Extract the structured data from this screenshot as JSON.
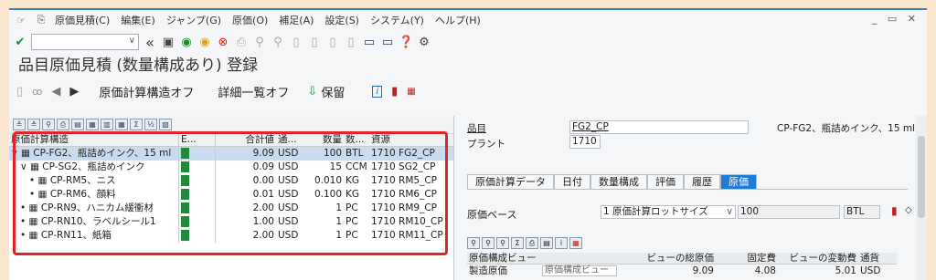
{
  "menu": {
    "items": [
      "原価見積(C)",
      "編集(E)",
      "ジャンプ(G)",
      "原価(O)",
      "補足(A)",
      "設定(S)",
      "システム(Y)",
      "ヘルプ(H)"
    ],
    "window_controls": "_ ▭ ✕"
  },
  "toolbar": {
    "command_placeholder": "",
    "icons": [
      "enter-icon",
      "save-icon",
      "back-icon",
      "exit-icon",
      "cancel-icon",
      "print-icon",
      "find-icon",
      "find-next-icon",
      "first-page-icon",
      "prev-page-icon",
      "next-page-icon",
      "last-page-icon",
      "new-session-icon",
      "shortcut-icon",
      "help-icon",
      "settings-icon"
    ]
  },
  "title": "品目原価見積 (数量構成あり) 登録",
  "apptoolbar": {
    "structure_off": "原価計算構造オフ",
    "detail_off": "詳細一覧オフ",
    "save": "保留"
  },
  "tree": {
    "headers": {
      "name": "原価計算構造",
      "e": "E...",
      "amount": "合計値",
      "cur": "通...",
      "qty": "数量",
      "unit": "数...",
      "resource": "資源"
    },
    "rows": [
      {
        "indent": "∨ ▦ ",
        "name": "CP-FG2、瓶詰めインク、15 ml",
        "amount": "9.09",
        "cur": "USD",
        "qty": "100",
        "unit": "BTL",
        "resource": "1710 FG2_CP",
        "selected": true
      },
      {
        "indent": "   ∨ ▦ ",
        "name": "CP-SG2、瓶詰めインク",
        "amount": "0.09",
        "cur": "USD",
        "qty": "15",
        "unit": "CCM",
        "resource": "1710 SG2_CP",
        "selected": false
      },
      {
        "indent": "      • ▦ ",
        "name": "CP-RM5、ニス",
        "amount": "0.00",
        "cur": "USD",
        "qty": "0.010",
        "unit": "KG",
        "resource": "1710 RM5_CP",
        "selected": false
      },
      {
        "indent": "      • ▦ ",
        "name": "CP-RM6、顔料",
        "amount": "0.01",
        "cur": "USD",
        "qty": "0.100",
        "unit": "KG",
        "resource": "1710 RM6_CP",
        "selected": false
      },
      {
        "indent": "   • ▦ ",
        "name": "CP-RN9、ハニカム緩衝材",
        "amount": "2.00",
        "cur": "USD",
        "qty": "1",
        "unit": "PC",
        "resource": "1710 RM9_CP",
        "selected": false
      },
      {
        "indent": "   • ▦ ",
        "name": "CP-RN10、ラベルシール1",
        "amount": "1.00",
        "cur": "USD",
        "qty": "1",
        "unit": "PC",
        "resource": "1710 RM10_CP",
        "selected": false
      },
      {
        "indent": "   • ▦ ",
        "name": "CP-RN11、紙箱",
        "amount": "2.00",
        "cur": "USD",
        "qty": "1",
        "unit": "PC",
        "resource": "1710 RM11_CP",
        "selected": false
      }
    ]
  },
  "detail": {
    "material_label": "品目",
    "material_value": "FG2_CP",
    "material_desc": "CP-FG2、瓶詰めインク、15 ml",
    "plant_label": "プラント",
    "plant_value": "1710",
    "tabs": [
      "原価計算データ",
      "日付",
      "数量構成",
      "評価",
      "履歴",
      "原価"
    ],
    "active_tab": 5,
    "cost_base_label": "原価ベース",
    "cost_base_value": "1 原価計算ロットサイズ",
    "cost_base_qty": "100",
    "cost_base_unit": "BTL",
    "table": {
      "headers": [
        "原価構成ビュー",
        "ビューの総原価",
        "固定費",
        "ビューの変動費",
        "通貨"
      ],
      "row": {
        "view": "製造原価",
        "view_field": "原価構成ビュー",
        "total": "9.09",
        "fixed": "4.08",
        "variable": "5.01",
        "currency": "USD"
      }
    }
  },
  "colors": {
    "accent": "#1f7bd8",
    "highlight_box": "#e0252a",
    "status_green": "#1e8a3a"
  }
}
